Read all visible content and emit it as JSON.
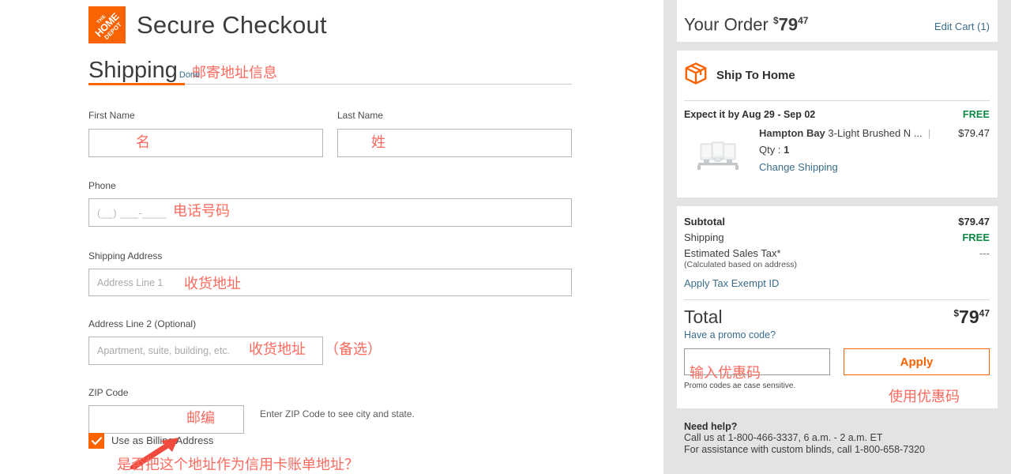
{
  "header": {
    "logo_alt": "home-depot-logo",
    "title": "Secure Checkout"
  },
  "shipping_section": {
    "heading": "Shipping",
    "done_link": "Done",
    "annotation": "邮寄地址信息",
    "fields": {
      "first_name": {
        "label": "First Name",
        "value": "",
        "placeholder": "",
        "annotation": "名"
      },
      "last_name": {
        "label": "Last Name",
        "value": "",
        "placeholder": "",
        "annotation": "姓"
      },
      "phone": {
        "label": "Phone",
        "value": "",
        "placeholder": "(__) ___-____",
        "annotation": "电话号码"
      },
      "address1": {
        "label": "Shipping Address",
        "value": "",
        "placeholder": "Address Line 1",
        "annotation": "收货地址"
      },
      "address2": {
        "label": "Address Line 2 (Optional)",
        "value": "",
        "placeholder": "Apartment, suite, building, etc.",
        "annotation": "收货地址",
        "annotation2": "（备选）"
      },
      "zip": {
        "label": "ZIP Code",
        "value": "",
        "placeholder": "",
        "annotation": "邮编",
        "hint": "Enter ZIP Code to see city and state."
      }
    },
    "billing_checkbox": {
      "label": "Use as Billing Address",
      "checked": true,
      "annotation": "是否把这个地址作为信用卡账单地址？"
    }
  },
  "order_summary": {
    "title": "Your Order",
    "total_dollar_sign": "$",
    "total_dollars": "79",
    "total_cents": "47",
    "edit_cart": "Edit Cart (1)"
  },
  "fulfillment": {
    "icon": "package-box-icon",
    "method": "Ship To Home",
    "expect_label": "Expect it by Aug 29 - Sep 02",
    "shipping_cost": "FREE",
    "item": {
      "brand": "Hampton Bay",
      "name": " 3-Light Brushed N ...",
      "separator": "|",
      "price": "$79.47",
      "qty_label": "Qty : ",
      "qty_value": "1",
      "change_shipping": "Change Shipping",
      "thumb_alt": "3-light-vanity-fixture-thumbnail"
    }
  },
  "totals": {
    "rows": [
      {
        "label": "Subtotal",
        "value": "$79.47",
        "bold": true,
        "kind": "plain"
      },
      {
        "label": "Shipping",
        "value": "FREE",
        "bold": false,
        "kind": "free"
      },
      {
        "label": "Estimated Sales Tax*",
        "value": "---",
        "bold": false,
        "kind": "dash"
      }
    ],
    "tax_note": "(Calculated based on address)",
    "tax_exempt_link": "Apply Tax Exempt ID",
    "grand_label": "Total",
    "grand_dollar_sign": "$",
    "grand_dollars": "79",
    "grand_cents": "47",
    "promo_link": "Have a promo code?",
    "promo_input_value": "",
    "promo_input_placeholder": "",
    "promo_input_annotation": "输入优惠码",
    "apply_button": "Apply",
    "apply_annotation": "使用优惠码",
    "promo_note": "Promo codes ae case sensitive."
  },
  "help": {
    "title": "Need help?",
    "line1": "Call us at 1-800-466-3337, 6 a.m. - 2 a.m. ET",
    "line2": "For assistance with custom blinds, call 1-800-658-7320"
  },
  "colors": {
    "brand_orange": "#f96302",
    "link_blue": "#3b6c8a",
    "free_green": "#0c8a44",
    "annotation_red": "#fb6a5e",
    "sidebar_bg": "#e3e3e3"
  }
}
